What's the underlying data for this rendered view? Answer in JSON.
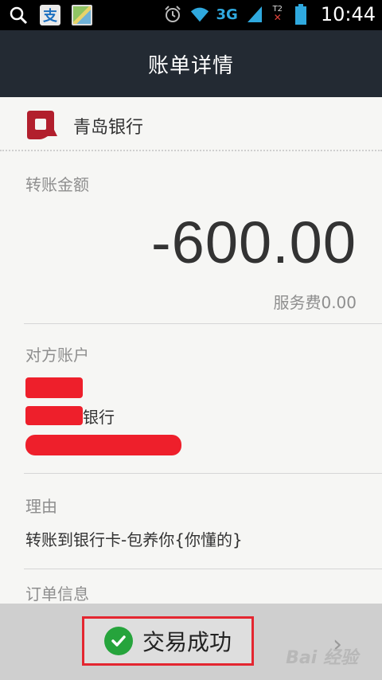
{
  "status_bar": {
    "network": "3G",
    "sim2_label": "T2",
    "time": "10:44",
    "icons": [
      "search-icon",
      "alipay-app-icon",
      "image-app-icon",
      "alarm-icon",
      "wifi-icon",
      "signal-icon",
      "sim2-icon",
      "battery-icon"
    ]
  },
  "header": {
    "title": "账单详情"
  },
  "bank": {
    "name": "青岛银行",
    "logo_color": "#b21f2d"
  },
  "transfer": {
    "label": "转账金额",
    "amount": "-600.00",
    "fee": "服务费0.00"
  },
  "counterparty": {
    "label": "对方账户",
    "bank_suffix": "银行"
  },
  "reason": {
    "label": "理由",
    "text": "转账到银行卡-包养你{你懂的}"
  },
  "order": {
    "label": "订单信息"
  },
  "footer": {
    "status": "交易成功",
    "status_color": "#26a43c",
    "highlight_color": "#e42630",
    "watermark": "Bai 经验"
  }
}
